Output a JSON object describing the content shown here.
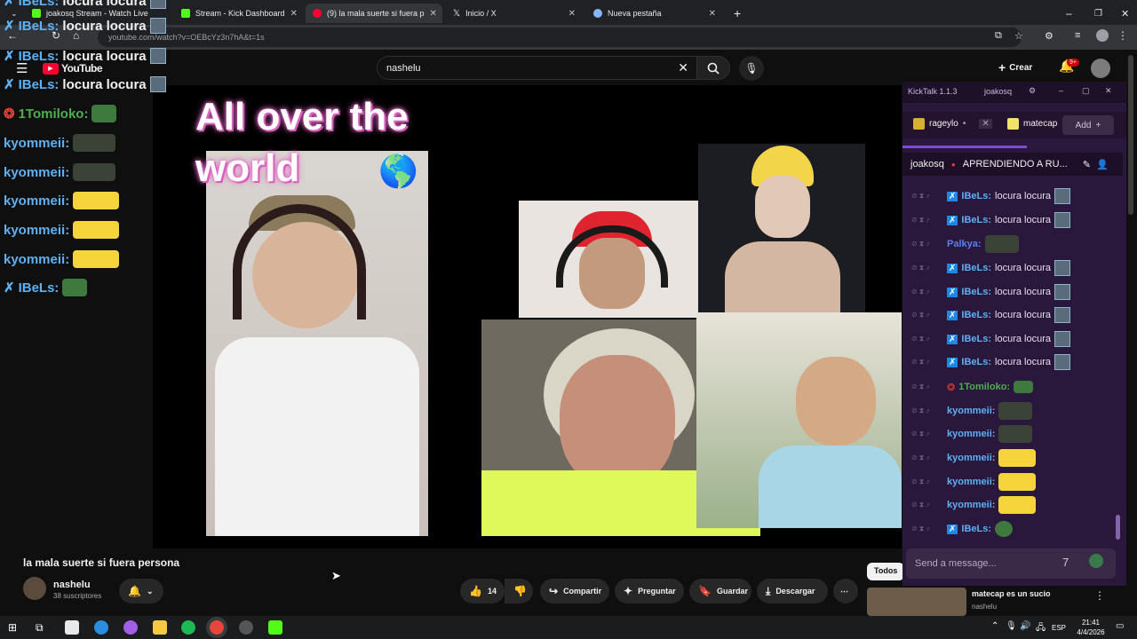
{
  "browser": {
    "tabs": [
      {
        "label": "joakosq Stream - Watch Live o",
        "color": "#53fc18"
      },
      {
        "label": "Stream - Kick Dashboard",
        "color": "#53fc18"
      },
      {
        "label": "(9) la mala suerte si fuera p",
        "color": "#ff0033"
      },
      {
        "label": "Inicio / X",
        "color": "#ffffff"
      },
      {
        "label": "Nueva pestaña",
        "color": "#8ab4f8"
      }
    ],
    "url": "youtube.com/watch?v=OEBcYz3n7hA&t=1s"
  },
  "youtube": {
    "logo": "YouTube",
    "search_value": "nashelu",
    "create_label": "Crear",
    "notif_badge": "9+",
    "video_caption": "All over the world",
    "video_title": "la mala suerte si fuera persona",
    "channel": {
      "name": "nashelu",
      "subs": "38 suscriptores"
    },
    "likes": "14",
    "actions": {
      "share": "Compartir",
      "ask": "Preguntar",
      "save": "Guardar",
      "download": "Descargar"
    },
    "filter_all": "Todos",
    "related": {
      "title": "matecap es un sucio",
      "channel": "nashelu"
    }
  },
  "overlay_chat": [
    {
      "user": "IBeLs:",
      "text": "locura locura",
      "color": "#5db1f5"
    },
    {
      "user": "IBeLs:",
      "text": "locura locura",
      "color": "#5db1f5"
    },
    {
      "user": "IBeLs:",
      "text": "locura locura",
      "color": "#5db1f5"
    },
    {
      "user": "IBeLs:",
      "text": "locura locura",
      "color": "#5db1f5"
    },
    {
      "user": "1Tomiloko:",
      "text": "",
      "color": "#4caf50"
    },
    {
      "user": "kyommeii:",
      "text": "",
      "color": "#5db1f5"
    },
    {
      "user": "kyommeii:",
      "text": "",
      "color": "#5db1f5"
    },
    {
      "user": "kyommeii:",
      "text": "",
      "color": "#5db1f5"
    },
    {
      "user": "kyommeii:",
      "text": "",
      "color": "#5db1f5"
    },
    {
      "user": "kyommeii:",
      "text": "",
      "color": "#5db1f5"
    },
    {
      "user": "IBeLs:",
      "text": "",
      "color": "#5db1f5"
    }
  ],
  "kicktalk": {
    "title": "KickTalk 1.1.3",
    "account": "joakosq",
    "tabs": [
      "rageylo",
      "matecap"
    ],
    "add_label": "Add",
    "channel": "joakosq",
    "stream_title": "APRENDIENDO A RU...",
    "messages": [
      {
        "user": "IBeLs:",
        "text": "locura locura",
        "color": "#5db1f5"
      },
      {
        "user": "IBeLs:",
        "text": "locura locura",
        "color": "#5db1f5"
      },
      {
        "user": "Palkya:",
        "text": "",
        "color": "#5b7ff0"
      },
      {
        "user": "IBeLs:",
        "text": "locura locura",
        "color": "#5db1f5"
      },
      {
        "user": "IBeLs:",
        "text": "locura locura",
        "color": "#5db1f5"
      },
      {
        "user": "IBeLs:",
        "text": "locura locura",
        "color": "#5db1f5"
      },
      {
        "user": "IBeLs:",
        "text": "locura locura",
        "color": "#5db1f5"
      },
      {
        "user": "IBeLs:",
        "text": "locura locura",
        "color": "#5db1f5"
      },
      {
        "user": "1Tomiloko:",
        "text": "",
        "color": "#4caf50"
      },
      {
        "user": "kyommeii:",
        "text": "",
        "color": "#5db1f5"
      },
      {
        "user": "kyommeii:",
        "text": "",
        "color": "#5db1f5"
      },
      {
        "user": "kyommeii:",
        "text": "",
        "color": "#5db1f5"
      },
      {
        "user": "kyommeii:",
        "text": "",
        "color": "#5db1f5"
      },
      {
        "user": "kyommeii:",
        "text": "",
        "color": "#5db1f5"
      },
      {
        "user": "IBeLs:",
        "text": "",
        "color": "#5db1f5"
      }
    ],
    "input_placeholder": "Send a message..."
  },
  "taskbar": {
    "lang": "ESP",
    "time": "21:41",
    "date": "4/4/2026"
  }
}
